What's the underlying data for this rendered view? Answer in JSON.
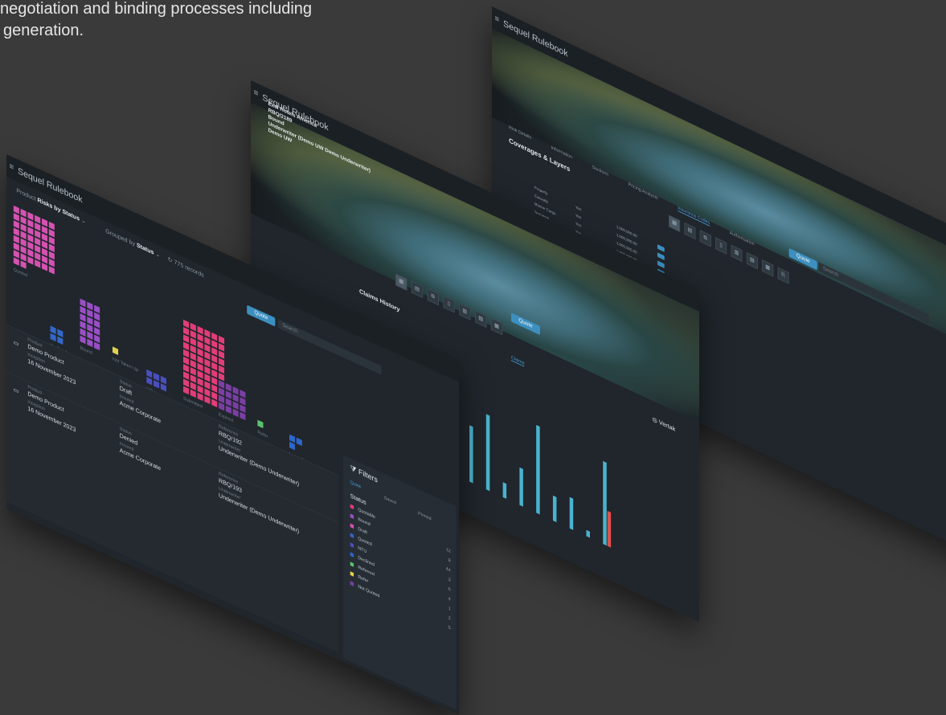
{
  "intro": {
    "line1": "negotiation and binding processes including",
    "line2": "generation."
  },
  "app_title": "Sequel Rulebook",
  "brand": "Vertak",
  "win_back": {
    "tabs": [
      "Risk Details",
      "Information",
      "Sections",
      "Pricing Analysis",
      "Insurance Codes",
      "Authorisation"
    ],
    "section_title": "Coverages & Layers",
    "table_rows": [
      [
        "Property",
        "Yes",
        "1,000,000.00"
      ],
      [
        "Casualty",
        "Yes",
        "1,000,000.00"
      ],
      [
        "Marine Cargo",
        "Yes",
        "1,000,000.00"
      ],
      [
        "Terrorism",
        "Yes",
        "1,000,000.00"
      ]
    ]
  },
  "win_mid": {
    "hero_lines": [
      "Exel Hotels America",
      "RBQ/2189",
      "Bound",
      "Underwriter (Demo UW Demo Underwriter)",
      "Demo UW"
    ],
    "search_placeholder": "Search",
    "button": "Quote",
    "section_title": "Claims History",
    "tab_label": "Claims",
    "chart_data": {
      "type": "bar",
      "series": [
        {
          "values": [
            72,
            10,
            0,
            86,
            45,
            60,
            12,
            30,
            70,
            20,
            25,
            5,
            66
          ]
        },
        {
          "values": [
            0,
            0,
            0,
            0,
            0,
            0,
            0,
            0,
            0,
            0,
            0,
            0,
            28
          ]
        }
      ],
      "colors": [
        "#4ab3cf",
        "#e0504a"
      ]
    }
  },
  "win_front": {
    "toolbar": {
      "view_label": "Product",
      "view_value": "Risks by Status",
      "group_label": "Grouped by",
      "group_value": "Status",
      "count": "775 records",
      "button": "Quote",
      "search_placeholder": "Search"
    },
    "heat_groups": [
      {
        "label": "Quoted",
        "color": "#d452b0",
        "cells": 44
      },
      {
        "label": "Declined",
        "color": "#3367c7",
        "cells": 4
      },
      {
        "label": "Bound",
        "color": "#9a4fc7",
        "cells": 18
      },
      {
        "label": "Not Taken Up",
        "color": "#e1d14d",
        "cells": 1
      },
      {
        "label": "NTU",
        "color": "#4a4fbf",
        "cells": 6
      },
      {
        "label": "Submitted",
        "color": "#e23d78",
        "cells": 60
      },
      {
        "label": "Expired",
        "color": "#7a3fa5",
        "cells": 16
      },
      {
        "label": "Refer",
        "color": "#5ac26a",
        "cells": 1
      },
      {
        "label": "Lapsed",
        "color": "#2f66c9",
        "cells": 3
      }
    ],
    "rows": [
      {
        "product_label": "Product",
        "product": "Demo Product",
        "inception_label": "Inception",
        "inception": "16 November 2023",
        "status_label": "Status",
        "status": "Draft",
        "insured_label": "Insured",
        "insured": "Acme Corporate",
        "ref_label": "Reference",
        "ref": "RBQ/192",
        "uw_label": "Underwriter",
        "uw": "Underwriter (Demo Underwriter)"
      },
      {
        "product_label": "Product",
        "product": "Demo Product",
        "inception_label": "Inception",
        "inception": "16 November 2023",
        "status_label": "Status",
        "status": "Denied",
        "insured_label": "Insured",
        "insured": "Acme Corporate",
        "ref_label": "Reference",
        "ref": "RBQ/193",
        "uw_label": "Underwriter",
        "uw": "Underwriter (Demo Underwriter)"
      }
    ],
    "filters": {
      "title": "Filters",
      "tabs": [
        "Quick",
        "Saved",
        "Pinned"
      ],
      "section": "Status",
      "items": [
        {
          "label": "Quotable",
          "color": "#e23d78",
          "count": "12"
        },
        {
          "label": "Bound",
          "color": "#9a4fc7",
          "count": "8"
        },
        {
          "label": "Draft",
          "color": "#d452b0",
          "count": "44"
        },
        {
          "label": "Quoted",
          "color": "#3367c7",
          "count": "3"
        },
        {
          "label": "NTU",
          "color": "#4a4fbf",
          "count": "6"
        },
        {
          "label": "Declined",
          "color": "#2f66c9",
          "count": "4"
        },
        {
          "label": "Referred",
          "color": "#5ac26a",
          "count": "1"
        },
        {
          "label": "Refer",
          "color": "#e1d14d",
          "count": "2"
        },
        {
          "label": "Not Quoted",
          "color": "#7a3fa5",
          "count": "5"
        }
      ]
    }
  }
}
